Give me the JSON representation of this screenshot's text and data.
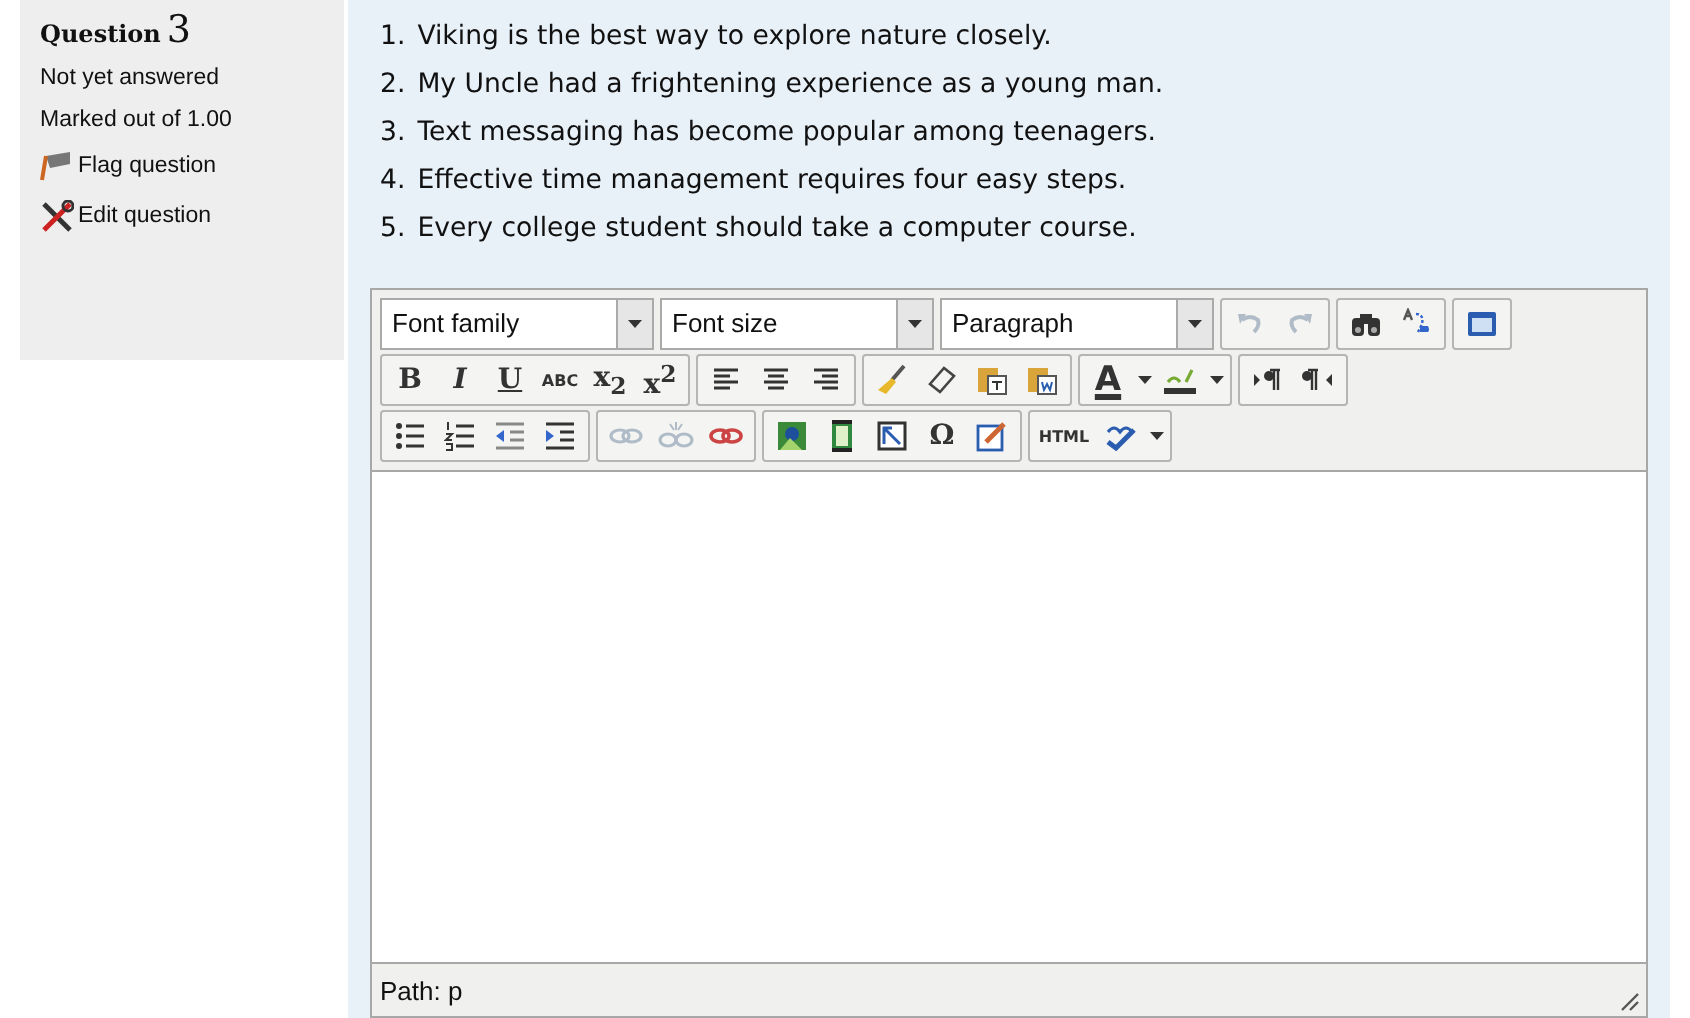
{
  "question_info": {
    "label": "Question",
    "number": "3",
    "status": "Not yet answered",
    "mark": "Marked out of 1.00",
    "actions": [
      {
        "kind": "flag",
        "label": "Flag question"
      },
      {
        "kind": "edit",
        "label": "Edit question"
      }
    ]
  },
  "items": [
    {
      "number": "1.",
      "text": "Viking is the best way to explore nature closely."
    },
    {
      "number": "2.",
      "text": "My Uncle had a frightening experience as a young man."
    },
    {
      "number": "3.",
      "text": "Text messaging has become popular among teenagers."
    },
    {
      "number": "4.",
      "text": "Effective time management requires four easy steps."
    },
    {
      "number": "5.",
      "text": "Every college student should take a computer course."
    }
  ],
  "editor": {
    "toolbar": [
      [
        [
          {
            "kind": "select",
            "value": "Font family"
          }
        ],
        [
          {
            "kind": "select",
            "value": "Font size"
          }
        ],
        [
          {
            "kind": "select",
            "value": "Paragraph"
          }
        ],
        [
          {
            "kind": "icon",
            "disabled": true
          },
          {
            "kind": "icon",
            "disabled": true
          }
        ],
        [
          {
            "kind": "icon",
            "disabled": false
          },
          {
            "kind": "icon",
            "disabled": false
          }
        ],
        [
          {
            "kind": "icon",
            "disabled": false
          }
        ]
      ],
      [
        [
          {
            "kind": "glyph",
            "text": "B",
            "disabled": false
          },
          {
            "kind": "glyph",
            "text": "I",
            "disabled": false
          },
          {
            "kind": "glyph",
            "text": "U",
            "disabled": false
          },
          {
            "kind": "glyph",
            "text": "ABC",
            "disabled": false
          },
          {
            "kind": "glyph",
            "text": "x$_{2}$",
            "disabled": false
          },
          {
            "kind": "glyph",
            "text": "x$^{2}$",
            "disabled": false
          }
        ],
        [
          {
            "kind": "icon",
            "disabled": false
          },
          {
            "kind": "icon",
            "disabled": false
          },
          {
            "kind": "icon",
            "disabled": false
          }
        ],
        [
          {
            "kind": "icon",
            "disabled": false
          },
          {
            "kind": "icon",
            "disabled": false
          },
          {
            "kind": "icon",
            "disabled": false
          },
          {
            "kind": "icon",
            "disabled": false
          }
        ],
        [
          {
            "kind": "glyph",
            "text": "A",
            "disabled": false
          },
          {
            "kind": "arrow"
          },
          {
            "kind": "icon",
            "disabled": false
          },
          {
            "kind": "arrow"
          }
        ],
        [
          {
            "kind": "icon",
            "disabled": false
          },
          {
            "kind": "icon",
            "disabled": false
          }
        ]
      ],
      [
        [
          {
            "kind": "icon",
            "disabled": false
          },
          {
            "kind": "icon",
            "disabled": false
          },
          {
            "kind": "icon",
            "disabled": false
          },
          {
            "kind": "icon",
            "disabled": false
          }
        ],
        [
          {
            "kind": "icon",
            "disabled": true
          },
          {
            "kind": "icon",
            "disabled": true
          },
          {
            "kind": "icon",
            "disabled": false
          }
        ],
        [
          {
            "kind": "icon",
            "disabled": false
          },
          {
            "kind": "icon",
            "disabled": false
          },
          {
            "kind": "icon",
            "disabled": false
          },
          {
            "kind": "glyph",
            "text": "Ω",
            "disabled": false
          },
          {
            "kind": "icon",
            "disabled": false
          }
        ],
        [
          {
            "kind": "glyph",
            "text": "HTML",
            "disabled": false
          },
          {
            "kind": "icon",
            "disabled": false
          },
          {
            "kind": "arrow"
          }
        ]
      ]
    ],
    "path": "Path: p"
  }
}
